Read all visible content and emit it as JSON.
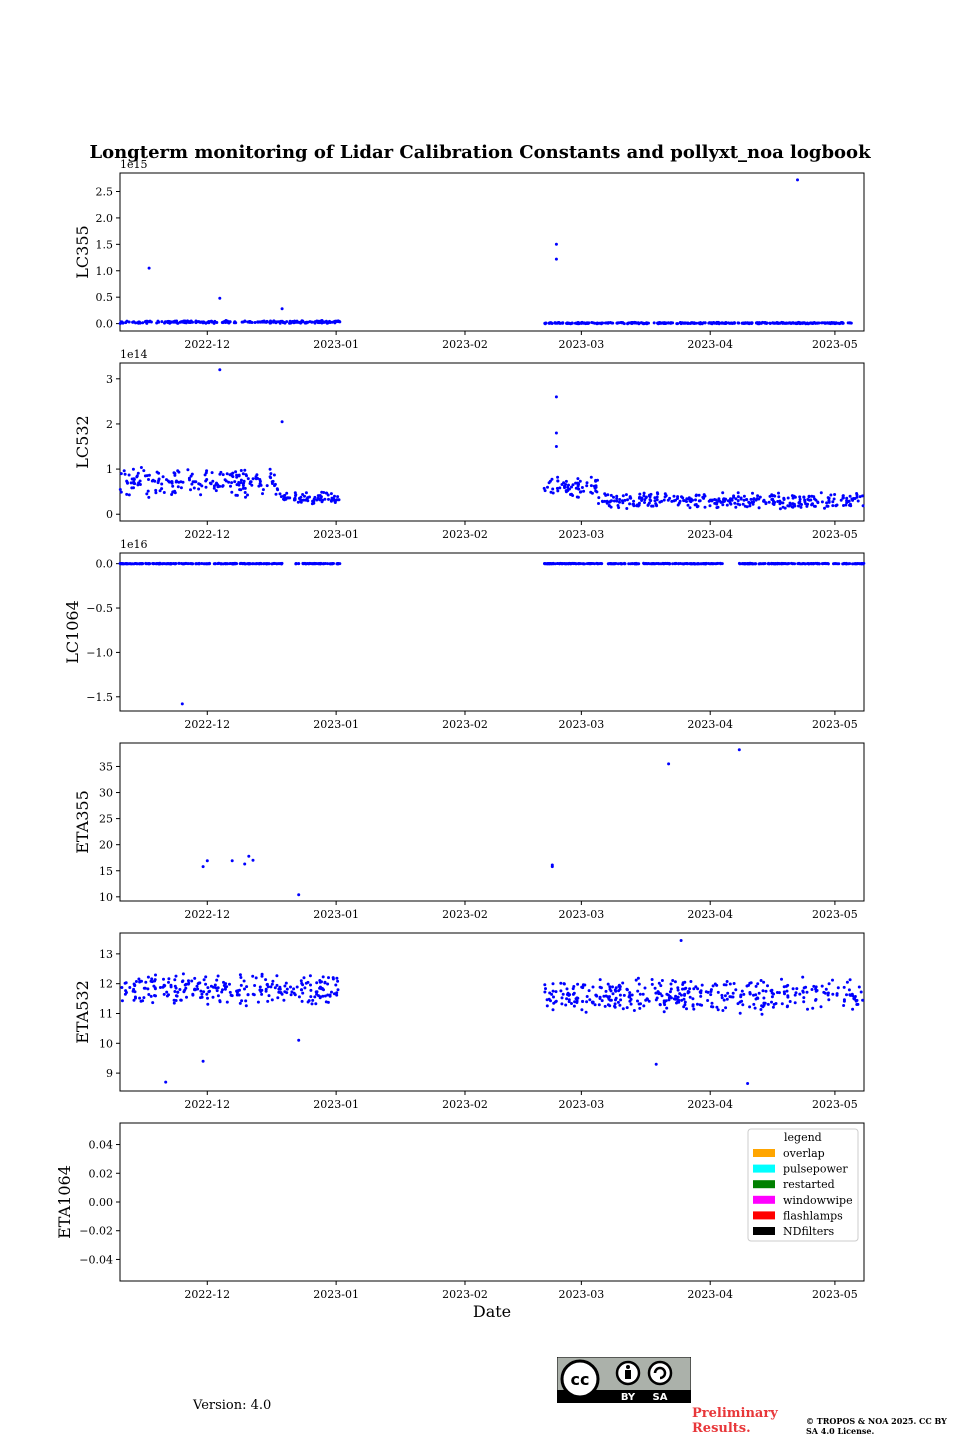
{
  "figure": {
    "title": "Longterm monitoring of Lidar Calibration Constants and pollyxt_noa logbook",
    "xlabel": "Date",
    "date_ticks": [
      "2022-12",
      "2023-01",
      "2023-02",
      "2023-03",
      "2023-04",
      "2023-05"
    ]
  },
  "footer": {
    "version": "Version: 4.0",
    "preliminary": "Preliminary Results.",
    "copyright": "© TROPOS & NOA 2025. CC BY SA 4.0 License.",
    "license_badge": {
      "cc": "cc",
      "by": "BY",
      "sa": "SA"
    }
  },
  "colors": {
    "points": "#0000ff",
    "overlap": "#ffa500",
    "pulsepower": "#00ffff",
    "restarted": "#008000",
    "windowwipe": "#ff00ff",
    "flashlamps": "#ff0000",
    "NDfilters": "#000000"
  },
  "chart_data": [
    {
      "type": "scatter",
      "ylabel": "LC355",
      "offset_text": "1e15",
      "x_range": [
        "2022-11-10",
        "2023-05-08"
      ],
      "ylim": [
        -0.14,
        2.85
      ],
      "yticks": [
        "0.0",
        "0.5",
        "1.0",
        "1.5",
        "2.0",
        "2.5"
      ],
      "ytick_values": [
        0,
        0.5,
        1.0,
        1.5,
        2.0,
        2.5
      ],
      "segments": [
        {
          "start": "2022-11-10",
          "end": "2023-01-02",
          "base": 0.03,
          "spread": 0.03
        },
        {
          "start": "2023-02-20",
          "end": "2023-05-05",
          "base": 0.01,
          "spread": 0.015
        }
      ],
      "outliers": [
        {
          "x": "2022-11-17",
          "y": 1.05
        },
        {
          "x": "2022-12-04",
          "y": 0.48
        },
        {
          "x": "2022-12-19",
          "y": 0.28
        },
        {
          "x": "2023-02-23",
          "y": 1.5
        },
        {
          "x": "2023-02-23",
          "y": 1.22
        },
        {
          "x": "2023-04-22",
          "y": 2.72
        }
      ]
    },
    {
      "type": "scatter",
      "ylabel": "LC532",
      "offset_text": "1e14",
      "x_range": [
        "2022-11-10",
        "2023-05-08"
      ],
      "ylim": [
        -0.15,
        3.35
      ],
      "yticks": [
        "0",
        "1",
        "2",
        "3"
      ],
      "ytick_values": [
        0,
        1,
        2,
        3
      ],
      "segments": [
        {
          "start": "2022-11-10",
          "end": "2022-12-18",
          "base": 0.7,
          "spread": 0.35
        },
        {
          "start": "2022-12-18",
          "end": "2023-01-02",
          "base": 0.35,
          "spread": 0.15
        },
        {
          "start": "2023-02-20",
          "end": "2023-03-05",
          "base": 0.6,
          "spread": 0.25
        },
        {
          "start": "2023-03-05",
          "end": "2023-05-08",
          "base": 0.3,
          "spread": 0.2
        }
      ],
      "outliers": [
        {
          "x": "2022-12-04",
          "y": 3.2
        },
        {
          "x": "2022-12-19",
          "y": 2.05
        },
        {
          "x": "2023-02-23",
          "y": 2.6
        },
        {
          "x": "2023-02-23",
          "y": 1.8
        },
        {
          "x": "2023-02-23",
          "y": 1.5
        }
      ]
    },
    {
      "type": "scatter",
      "ylabel": "LC1064",
      "offset_text": "1e16",
      "x_range": [
        "2022-11-10",
        "2023-05-08"
      ],
      "ylim": [
        -1.66,
        0.12
      ],
      "yticks": [
        "0.0",
        "−0.5",
        "−1.0",
        "−1.5"
      ],
      "ytick_values": [
        0,
        -0.5,
        -1.0,
        -1.5
      ],
      "segments": [
        {
          "start": "2022-11-10",
          "end": "2022-12-19",
          "base": 0.0,
          "spread": 0.004
        },
        {
          "start": "2022-12-22",
          "end": "2023-01-02",
          "base": 0.0,
          "spread": 0.004
        },
        {
          "start": "2023-02-20",
          "end": "2023-04-04",
          "base": 0.0,
          "spread": 0.004
        },
        {
          "start": "2023-04-08",
          "end": "2023-05-08",
          "base": 0.0,
          "spread": 0.004
        }
      ],
      "outliers": [
        {
          "x": "2022-11-25",
          "y": -1.58
        }
      ]
    },
    {
      "type": "scatter",
      "ylabel": "ETA355",
      "x_range": [
        "2022-11-10",
        "2023-05-08"
      ],
      "ylim": [
        9.2,
        39.5
      ],
      "yticks": [
        "10",
        "15",
        "20",
        "25",
        "30",
        "35"
      ],
      "ytick_values": [
        10,
        15,
        20,
        25,
        30,
        35
      ],
      "points": [
        {
          "x": "2022-11-30",
          "y": 15.8
        },
        {
          "x": "2022-12-01",
          "y": 16.9
        },
        {
          "x": "2022-12-07",
          "y": 16.9
        },
        {
          "x": "2022-12-10",
          "y": 16.3
        },
        {
          "x": "2022-12-11",
          "y": 17.8
        },
        {
          "x": "2022-12-12",
          "y": 17.0
        },
        {
          "x": "2022-12-23",
          "y": 10.4
        },
        {
          "x": "2023-02-22",
          "y": 15.8
        },
        {
          "x": "2023-02-22",
          "y": 16.1
        },
        {
          "x": "2023-03-22",
          "y": 35.5
        },
        {
          "x": "2023-04-08",
          "y": 38.2
        }
      ]
    },
    {
      "type": "scatter",
      "ylabel": "ETA532",
      "x_range": [
        "2022-11-10",
        "2023-05-08"
      ],
      "ylim": [
        8.4,
        13.7
      ],
      "yticks": [
        "9",
        "10",
        "11",
        "12",
        "13"
      ],
      "ytick_values": [
        9,
        10,
        11,
        12,
        13
      ],
      "segments": [
        {
          "start": "2022-11-10",
          "end": "2023-01-02",
          "base": 11.8,
          "spread": 0.55
        },
        {
          "start": "2023-02-20",
          "end": "2023-05-08",
          "base": 11.6,
          "spread": 0.65
        }
      ],
      "outliers": [
        {
          "x": "2022-11-21",
          "y": 8.7
        },
        {
          "x": "2022-11-30",
          "y": 9.4
        },
        {
          "x": "2022-12-23",
          "y": 10.1
        },
        {
          "x": "2023-03-19",
          "y": 9.3
        },
        {
          "x": "2023-03-25",
          "y": 13.45
        },
        {
          "x": "2023-04-10",
          "y": 8.65
        }
      ]
    },
    {
      "type": "scatter",
      "ylabel": "ETA1064",
      "x_range": [
        "2022-11-10",
        "2023-05-08"
      ],
      "ylim": [
        -0.055,
        0.055
      ],
      "yticks": [
        "0.04",
        "0.02",
        "0.00",
        "−0.02",
        "−0.04"
      ],
      "ytick_values": [
        0.04,
        0.02,
        0,
        -0.02,
        -0.04
      ],
      "points": [],
      "legend": {
        "title": "legend",
        "entries": [
          "overlap",
          "pulsepower",
          "restarted",
          "windowwipe",
          "flashlamps",
          "NDfilters"
        ],
        "placement": "upper right"
      }
    }
  ]
}
